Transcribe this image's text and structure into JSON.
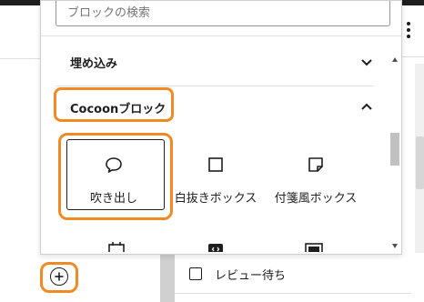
{
  "search": {
    "placeholder": "ブロックの検索",
    "value": ""
  },
  "categories": [
    {
      "label": "埋め込み",
      "expanded": false,
      "chevron": "chevron-down-icon"
    },
    {
      "label": "Cocoonブロック",
      "expanded": true,
      "chevron": "chevron-up-icon"
    }
  ],
  "blocks": [
    {
      "label": "吹き出し",
      "icon": "speech-bubble-icon",
      "selected": true
    },
    {
      "label": "白抜きボックス",
      "icon": "square-outline-icon",
      "selected": false
    },
    {
      "label": "付箋風ボックス",
      "icon": "sticky-note-icon",
      "selected": false
    }
  ],
  "partial_blocks": [
    {
      "icon": "calendar-box-icon"
    },
    {
      "icon": "code-box-icon"
    },
    {
      "icon": "banner-box-icon"
    }
  ],
  "sidebar": {
    "review_label": "レビュー待ち",
    "review_checked": false
  },
  "colors": {
    "highlight": "#f28a24",
    "text": "#1e1e1e"
  },
  "inserter_toggle": {
    "icon": "plus-circle-icon"
  }
}
